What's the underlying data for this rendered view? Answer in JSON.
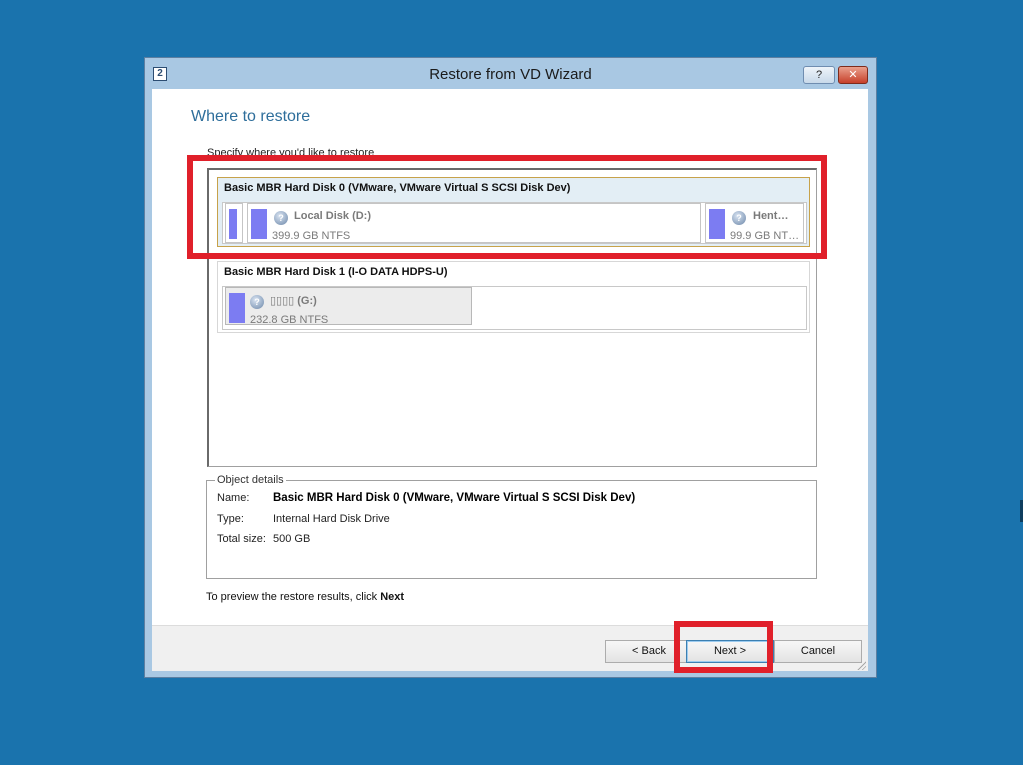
{
  "window": {
    "title": "Restore from VD Wizard",
    "help_label": "?",
    "close_label": "✕",
    "app_icon_label": "2"
  },
  "page": {
    "step_title": "Where to restore",
    "instruction": "Specify where you'd like to restore"
  },
  "disks": [
    {
      "title": "Basic MBR Hard Disk 0 (VMware, VMware Virtual S SCSI Disk Dev)",
      "selected": true,
      "partitions": [
        {
          "name": "",
          "info": ""
        },
        {
          "name": "Local Disk (D:)",
          "info": "399.9 GB NTFS"
        },
        {
          "name": "Hent…",
          "info": "99.9 GB NT…"
        }
      ]
    },
    {
      "title": "Basic MBR Hard Disk 1 (I-O DATA HDPS-U)",
      "selected": false,
      "partitions": [
        {
          "name": "▯▯▯▯ (G:)",
          "info": "232.8 GB NTFS"
        }
      ]
    }
  ],
  "details": {
    "legend": "Object details",
    "name_label": "Name:",
    "name_value": "Basic MBR Hard Disk 0 (VMware, VMware Virtual S SCSI Disk Dev)",
    "type_label": "Type:",
    "type_value": "Internal Hard Disk Drive",
    "size_label": "Total size:",
    "size_value": "500 GB"
  },
  "preview": {
    "text": "To preview the restore results, click ",
    "bold": "Next"
  },
  "buttons": {
    "back": "< Back",
    "next": "Next >",
    "cancel": "Cancel"
  },
  "colors": {
    "desktop": "#1a73ad",
    "highlight": "#e0202a",
    "partition_bar": "#7c7cf2"
  },
  "icons": {
    "partition_status": "question-icon",
    "app": "wizard-app-icon"
  }
}
